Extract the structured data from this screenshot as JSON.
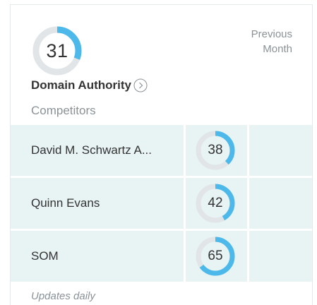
{
  "main_score": {
    "value": "31",
    "percent": 31
  },
  "header": {
    "previous_label_line1": "Previous",
    "previous_label_line2": "Month",
    "title": "Domain Authority",
    "subtitle": "Competitors"
  },
  "competitors": [
    {
      "name": "David M. Schwartz A...",
      "score": "38",
      "percent": 38
    },
    {
      "name": "Quinn Evans",
      "score": "42",
      "percent": 42
    },
    {
      "name": "SOM",
      "score": "65",
      "percent": 65
    }
  ],
  "footer": {
    "note": "Updates daily"
  },
  "colors": {
    "accent": "#4db9ea",
    "ring_track": "#e1e5e7",
    "row_bg": "#e8f3f4",
    "muted_text": "#8a9297"
  },
  "icons": {
    "info": "chevron-right-circle-icon"
  }
}
